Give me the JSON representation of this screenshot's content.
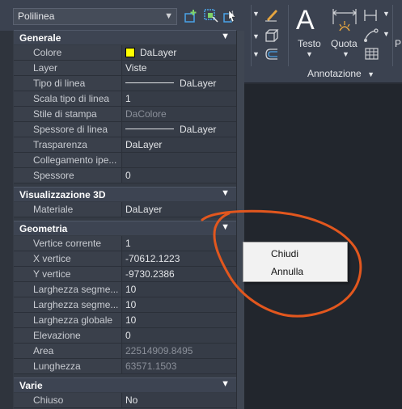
{
  "palette": {
    "object_type": "Polilinea",
    "toolbar_icons": [
      "quick-select-icon",
      "select-objects-icon",
      "toggle-pickadd-icon"
    ]
  },
  "sections": {
    "generale": {
      "title": "Generale"
    },
    "vis3d": {
      "title": "Visualizzazione 3D"
    },
    "geometria": {
      "title": "Geometria"
    },
    "varie": {
      "title": "Varie"
    }
  },
  "generale": {
    "colore": {
      "label": "Colore",
      "value": "DaLayer",
      "swatch": "#ffff00"
    },
    "layer": {
      "label": "Layer",
      "value": "Viste"
    },
    "tipo_linea": {
      "label": "Tipo di linea",
      "value": "DaLayer"
    },
    "scala_tipo_linea": {
      "label": "Scala tipo di linea",
      "value": "1"
    },
    "stile_stampa": {
      "label": "Stile di stampa",
      "value": "DaColore"
    },
    "spessore_linea": {
      "label": "Spessore di linea",
      "value": "DaLayer"
    },
    "trasparenza": {
      "label": "Trasparenza",
      "value": "DaLayer"
    },
    "collegamento": {
      "label": "Collegamento  ipe...",
      "value": ""
    },
    "spessore": {
      "label": "Spessore",
      "value": "0"
    }
  },
  "vis3d": {
    "materiale": {
      "label": "Materiale",
      "value": "DaLayer"
    }
  },
  "geometria": {
    "vertice_corrente": {
      "label": "Vertice corrente",
      "value": "1"
    },
    "x_vertice": {
      "label": "X vertice",
      "value": "-70612.1223"
    },
    "y_vertice": {
      "label": "Y vertice",
      "value": "-9730.2386"
    },
    "larghezza_seg_iniz": {
      "label": "Larghezza  segme...",
      "value": "10"
    },
    "larghezza_seg_fin": {
      "label": "Larghezza  segme...",
      "value": "10"
    },
    "larghezza_globale": {
      "label": "Larghezza globale",
      "value": "10"
    },
    "elevazione": {
      "label": "Elevazione",
      "value": "0"
    },
    "area": {
      "label": "Area",
      "value": "22514909.8495"
    },
    "lunghezza": {
      "label": "Lunghezza",
      "value": "63571.1503"
    }
  },
  "varie": {
    "chiuso": {
      "label": "Chiuso",
      "value": "No"
    }
  },
  "ribbon": {
    "testo_label": "Testo",
    "quota_label": "Quota",
    "panel_title": "Annotazione",
    "overflow_label": "P"
  },
  "context_menu": {
    "items": [
      "Chiudi",
      "Annulla"
    ]
  },
  "colors": {
    "annotation_stroke": "#e2571e",
    "swatch": "#ffff00"
  }
}
